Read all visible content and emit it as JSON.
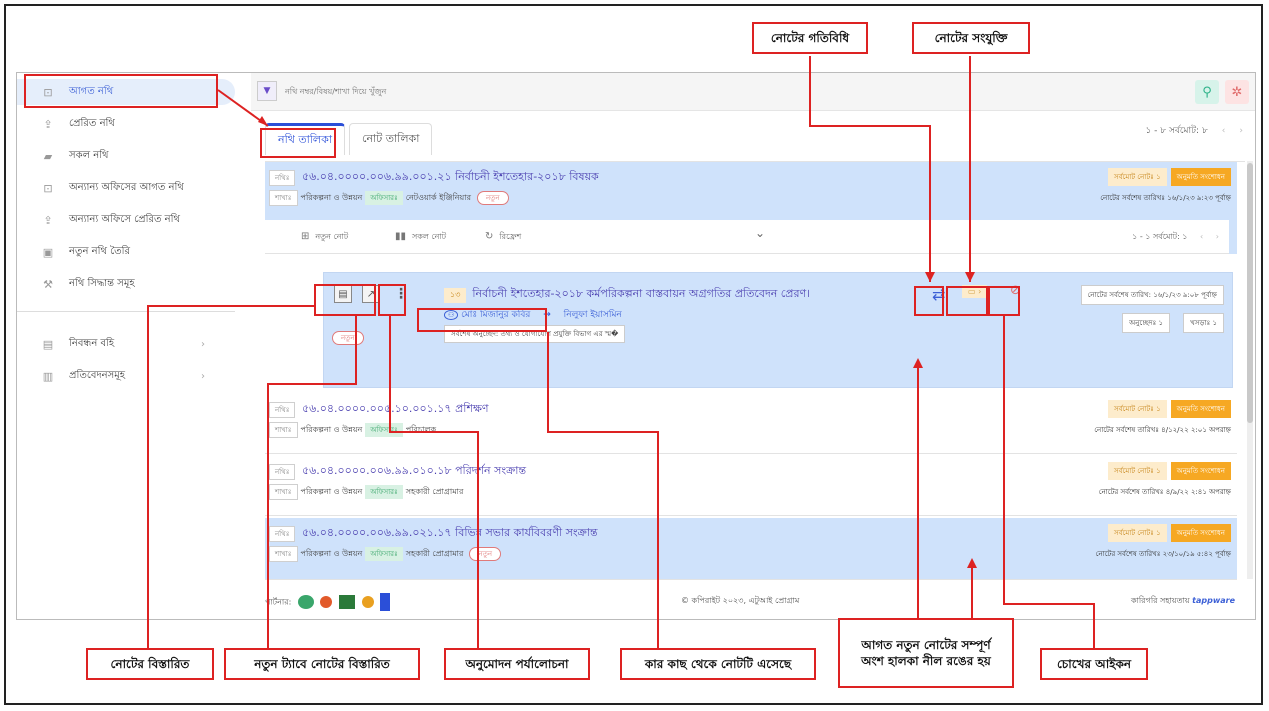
{
  "sidebar": {
    "items": [
      {
        "label": "আগত নথি",
        "icon": "inbox-icon"
      },
      {
        "label": "প্রেরিত নথি",
        "icon": "upload-icon"
      },
      {
        "label": "সকল নথি",
        "icon": "folder-icon"
      },
      {
        "label": "অন্যান্য অফিসের আগত নথি",
        "icon": "inbox-icon"
      },
      {
        "label": "অন্যান্য অফিসে প্রেরিত নথি",
        "icon": "upload-icon"
      },
      {
        "label": "নতুন নথি তৈরি",
        "icon": "new-file-icon"
      },
      {
        "label": "নথি সিদ্ধান্ত সমূহ",
        "icon": "gavel-icon"
      },
      {
        "label": "নিবন্ধন বহি",
        "icon": "book-icon"
      },
      {
        "label": "প্রতিবেদনসমূহ",
        "icon": "report-icon"
      }
    ]
  },
  "search": {
    "placeholder": "নথি নম্বর/বিষয়/শাখা দিয়ে খুঁজুন"
  },
  "tabs": [
    "নথি তালিকা",
    "নোট তালিকা"
  ],
  "pager": {
    "text": "১ - ৮  সর্বমোট: ৮"
  },
  "labels": {
    "nothi": "নথিঃ",
    "shakha": "শাখাঃ",
    "officer": "অফিসারঃ",
    "new": "নতুন",
    "total_note": "সর্বমোট নোটঃ ১",
    "approve": "অনুমতি সংশোধন"
  },
  "files": [
    {
      "number": "৫৬.০৪.০০০০.০০৬.৯৯.০০১.২১",
      "title": "নির্বাচনী ইশতেহার-২০১৮ বিষয়ক",
      "branch": "পরিকল্পনা ও উন্নয়ন",
      "officer": "নেটওয়ার্ক ইঞ্জিনিয়ার",
      "last": "নোটের সর্বশেষ তারিখঃ ১৬/১/২৩ ৯:২৩ পূর্বাহ্ন"
    },
    {
      "number": "৫৬.০৪.০০০০.০০৫.১০.০০১.১৭",
      "title": "প্রশিক্ষণ",
      "branch": "পরিকল্পনা ও উন্নয়ন",
      "officer": "পরিচালক",
      "last": "নোটের সর্বশেষ তারিখঃ ৪/১২/২২ ২:০১ অপরাহ্ন"
    },
    {
      "number": "৫৬.০৪.০০০০.০০৬.৯৯.০১০.১৮",
      "title": "পরিদর্শন সংক্রান্ত",
      "branch": "পরিকল্পনা ও উন্নয়ন",
      "officer": "সহকারী প্রোগ্রামার",
      "last": "নোটের সর্বশেষ তারিখঃ ৪/৯/২২ ২:৪১ অপরাহ্ন"
    },
    {
      "number": "৫৬.০৪.০০০০.০০৬.৯৯.০২১.১৭",
      "title": "বিভিন্ন সভার কার্যবিবরণী সংক্রান্ত",
      "branch": "পরিকল্পনা ও উন্নয়ন",
      "officer": "সহকারী প্রোগ্রামার",
      "last": "নোটের সর্বশেষ তারিখঃ ২৩/১০/১৯ ৫:৪২ পূর্বাহ্ন"
    }
  ],
  "notebar": {
    "new_note": "নতুন নোট",
    "all_note": "সকল নোট",
    "refresh": "রিফ্রেশ",
    "pager": "১ - ১  সর্বমোট: ১"
  },
  "note": {
    "num": "১৩",
    "title": "নির্বাচনী ইশতেহার-২০১৮ কর্মপরিকল্পনা বাস্তবায়ন অগ্রগতির প্রতিবেদন প্রেরণ।",
    "from": "মোঃ মিজানুর কবির",
    "to": "নিলুফা ইয়াসমিন",
    "last_para": "সর্বশেষ অনুচ্ছেদ: তথ্য ও যোগাযোগ প্রযুক্তি বিভাগ এর স্ম�",
    "date": "নোটের সর্বশেষ তারিখ: ১৬/১/২৩ ৯:০৮ পূর্বাহ্ন",
    "onucched": "অনুচ্ছেদঃ ১",
    "khosra": "খসড়াঃ ১"
  },
  "footer": {
    "partner": "পার্টনার:",
    "copyright": "© কপিরাইট ২০২৩, এটুআই প্রোগ্রাম",
    "support": "কারিগরি সহায়তায়",
    "brand": "tappware"
  },
  "annotations": {
    "top1": "নোটের গতিবিধি",
    "top2": "নোটের সংযুক্তি",
    "b1": "নোটের বিস্তারিত",
    "b2": "নতুন ট্যাবে নোটের বিস্তারিত",
    "b3": "অনুমোদন পর্যালোচনা",
    "b4": "কার কাছ থেকে নোটটি এসেছে",
    "b5a": "আগত নতুন নোটের সম্পূর্ণ",
    "b5b": "অংশ হালকা নীল রঙের হয়",
    "b6": "চোখের আইকন"
  },
  "colors": {
    "accent": "#2b4fd8",
    "highlight": "#cfe2fb",
    "annotation": "#dd2222",
    "approve": "#f6a823"
  }
}
